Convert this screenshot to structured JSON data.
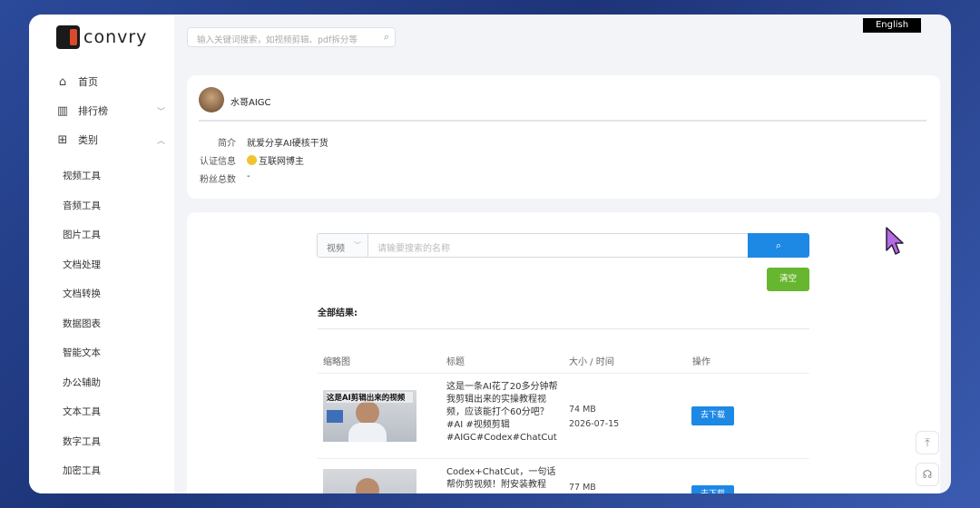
{
  "header": {
    "logo_text": "convry",
    "search_placeholder": "输入关键词搜索，如视频剪辑、pdf拆分等",
    "language_button": "English"
  },
  "sidebar": {
    "items": [
      {
        "label": "首页",
        "icon": "home-icon"
      },
      {
        "label": "排行榜",
        "icon": "bar-chart-icon"
      },
      {
        "label": "类别",
        "icon": "grid-icon"
      }
    ],
    "sub_items": [
      "视频工具",
      "音频工具",
      "图片工具",
      "文档处理",
      "文档转换",
      "数据图表",
      "智能文本",
      "办公辅助",
      "文本工具",
      "数字工具",
      "加密工具"
    ]
  },
  "profile": {
    "name": "水哥AIGC",
    "intro_label": "简介",
    "intro_value": "就爱分享AI硬核干货",
    "cert_label": "认证信息",
    "cert_value": "互联网博主",
    "fans_label": "粉丝总数",
    "fans_value": "-"
  },
  "search": {
    "type_selected": "视频",
    "placeholder": "请输要搜索的名称",
    "clear_label": "清空",
    "results_label": "全部结果:"
  },
  "table": {
    "headers": [
      "缩略图",
      "标题",
      "大小 / 时间",
      "操作"
    ],
    "rows": [
      {
        "thumb_caption": "这是AI剪辑出来的视频",
        "title": "这是一条AI花了20多分钟帮我剪辑出来的实操教程视频，应该能打个60分吧？#AI #视频剪辑#AIGC#Codex#ChatCut",
        "size": "74 MB",
        "date": "2026-07-15",
        "action": "去下载"
      },
      {
        "thumb_caption": "",
        "title": "Codex+ChatCut，一句话帮你剪视频！附安装教程#AI#A",
        "size": "77 MB",
        "date": "",
        "action": "去下载"
      }
    ]
  },
  "colors": {
    "primary_blue": "#1e88e5",
    "clear_green": "#67b62f",
    "background": "#f3f4f8"
  }
}
